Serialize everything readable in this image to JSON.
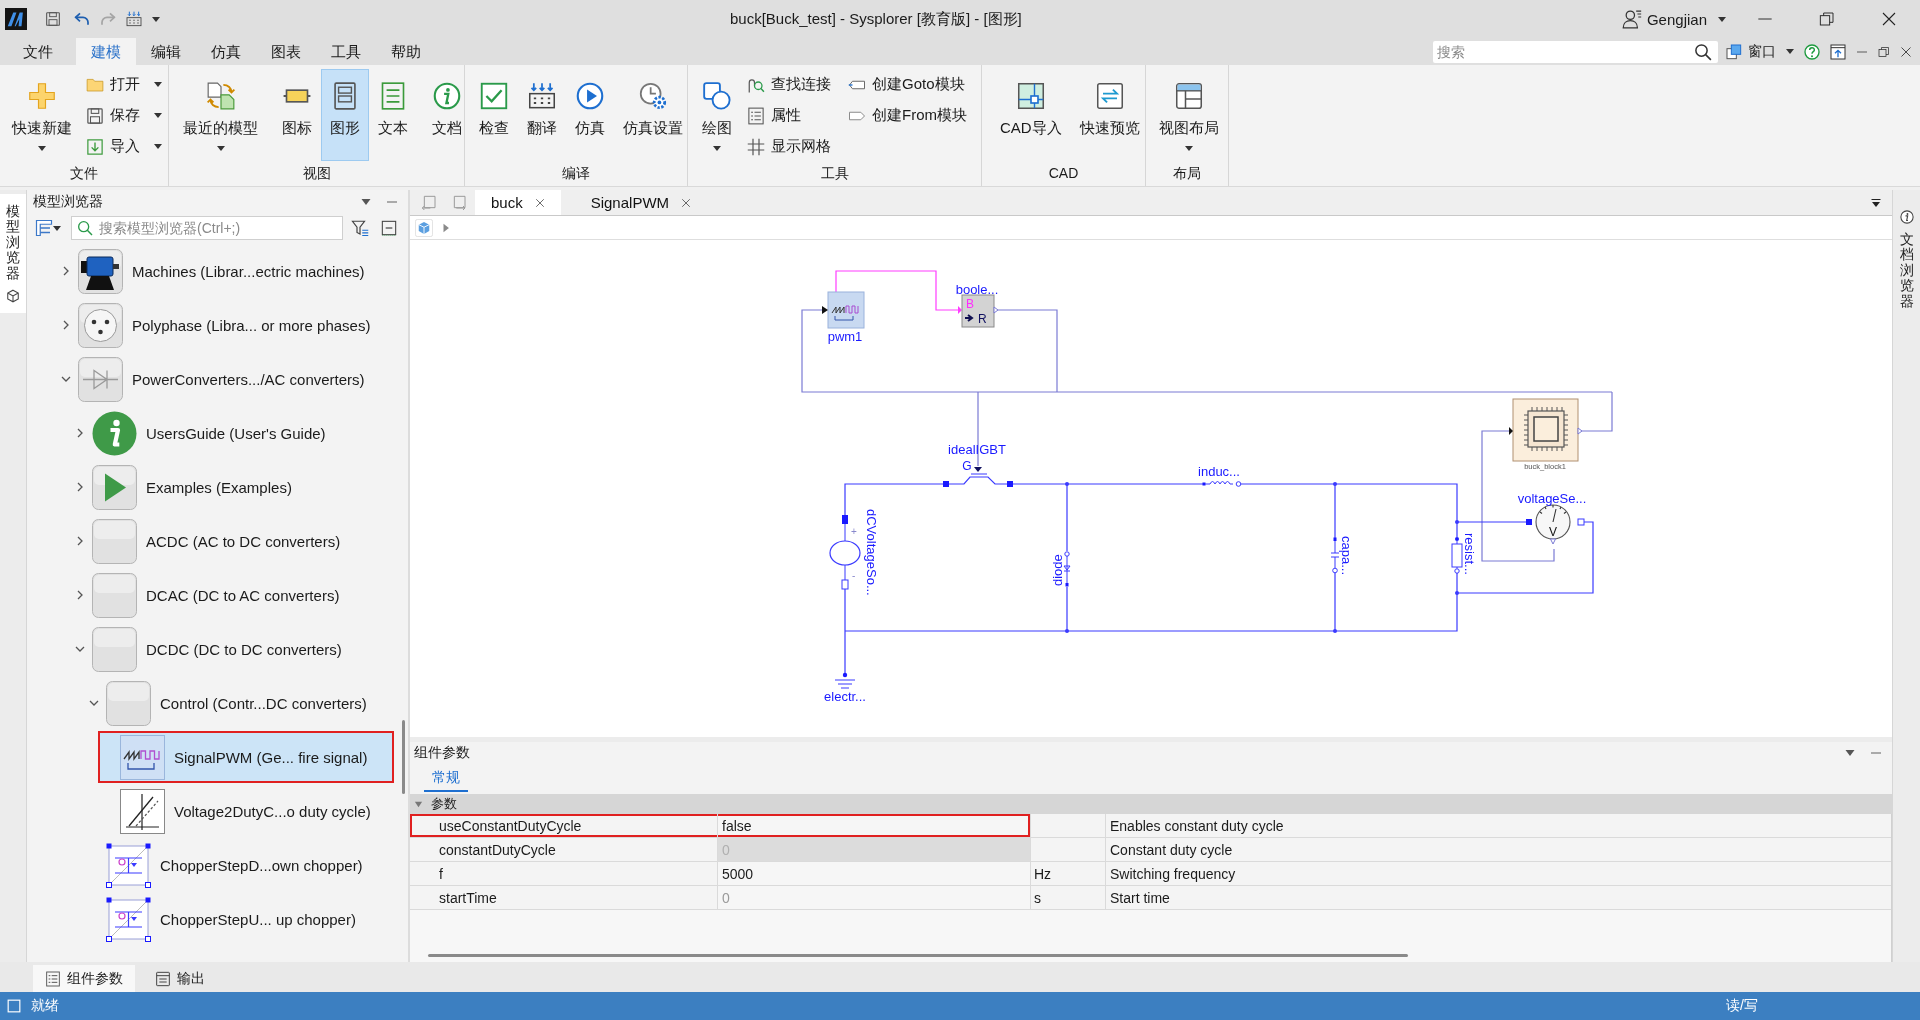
{
  "window": {
    "title": "buck[Buck_test] - Sysplorer [教育版] - [图形]",
    "user": "Gengjian"
  },
  "menu": [
    {
      "label": "文件",
      "selected": false
    },
    {
      "label": "建模",
      "selected": true
    },
    {
      "label": "编辑",
      "selected": false
    },
    {
      "label": "仿真",
      "selected": false
    },
    {
      "label": "图表",
      "selected": false
    },
    {
      "label": "工具",
      "selected": false
    },
    {
      "label": "帮助",
      "selected": false
    }
  ],
  "search": {
    "placeholder": "搜索"
  },
  "window_menu": {
    "label": "窗口"
  },
  "ribbon": {
    "groups": [
      {
        "label": "文件",
        "controls": [
          {
            "kind": "large",
            "label": "快速新建",
            "dropdown": true
          },
          {
            "kind": "stack",
            "items": [
              {
                "label": "打开",
                "dropdown": true
              },
              {
                "label": "保存",
                "dropdown": true
              },
              {
                "label": "导入",
                "dropdown": true
              }
            ]
          }
        ]
      },
      {
        "label": "视图",
        "controls": [
          {
            "kind": "large",
            "label": "最近的模型",
            "dropdown": true,
            "selected": false
          },
          {
            "kind": "separator"
          },
          {
            "kind": "large",
            "label": "图标",
            "selected": false
          },
          {
            "kind": "large",
            "label": "图形",
            "selected": true
          },
          {
            "kind": "large",
            "label": "文本",
            "selected": false
          },
          {
            "kind": "separator"
          },
          {
            "kind": "large",
            "label": "文档",
            "selected": false
          }
        ]
      },
      {
        "label": "编译",
        "controls": [
          {
            "kind": "large",
            "label": "检查"
          },
          {
            "kind": "large",
            "label": "翻译"
          },
          {
            "kind": "large",
            "label": "仿真"
          },
          {
            "kind": "large",
            "label": "仿真设置"
          }
        ]
      },
      {
        "label": "工具",
        "controls": [
          {
            "kind": "large",
            "label": "绘图",
            "dropdown": true
          },
          {
            "kind": "stack",
            "items": [
              {
                "label": "查找连接"
              },
              {
                "label": "属性"
              },
              {
                "label": "显示网格"
              }
            ]
          },
          {
            "kind": "stack",
            "items": [
              {
                "label": "创建Goto模块"
              },
              {
                "label": "创建From模块"
              }
            ]
          }
        ]
      },
      {
        "label": "CAD",
        "controls": [
          {
            "kind": "large",
            "label": "CAD导入"
          },
          {
            "kind": "large",
            "label": "快速预览"
          }
        ]
      },
      {
        "label": "布局",
        "controls": [
          {
            "kind": "large",
            "label": "视图布局",
            "dropdown": true
          }
        ]
      }
    ]
  },
  "side_tabs": {
    "left": {
      "label": "模型浏览器",
      "selected": true
    },
    "right": {
      "label": "文档浏览器",
      "selected": false
    }
  },
  "sidebar": {
    "title": "模型浏览器",
    "search": {
      "placeholder": "搜索模型浏览器(Ctrl+;)"
    },
    "tree": [
      {
        "label": "Machines (Librar...ectric machines)",
        "expanded": false,
        "selected": false,
        "highlighted": false
      },
      {
        "label": "Polyphase (Libra... or more phases)",
        "expanded": false,
        "selected": false,
        "highlighted": false
      },
      {
        "label": "PowerConverters.../AC converters)",
        "expanded": true,
        "selected": false,
        "highlighted": false,
        "children": [
          {
            "label": "UsersGuide (User's Guide)",
            "expanded": false,
            "selected": false,
            "highlighted": false
          },
          {
            "label": "Examples (Examples)",
            "expanded": false,
            "selected": false,
            "highlighted": false
          },
          {
            "label": "ACDC (AC to DC converters)",
            "expanded": false,
            "selected": false,
            "highlighted": false
          },
          {
            "label": "DCAC (DC to AC converters)",
            "expanded": false,
            "selected": false,
            "highlighted": false
          },
          {
            "label": "DCDC (DC to DC converters)",
            "expanded": true,
            "selected": false,
            "highlighted": false,
            "children": [
              {
                "label": "Control (Contr...DC converters)",
                "expanded": true,
                "selected": false,
                "highlighted": false,
                "children": [
                  {
                    "label": "SignalPWM (Ge... fire signal)",
                    "selected": true,
                    "highlighted": true
                  },
                  {
                    "label": "Voltage2DutyC...o duty cycle)",
                    "selected": false,
                    "highlighted": false
                  }
                ]
              },
              {
                "label": "ChopperStepD...own chopper)",
                "selected": false,
                "highlighted": false
              },
              {
                "label": "ChopperStepU... up chopper)",
                "selected": false,
                "highlighted": false
              }
            ]
          }
        ]
      }
    ]
  },
  "document_tabs": [
    {
      "label": "buck",
      "selected": true
    },
    {
      "label": "SignalPWM",
      "selected": false
    }
  ],
  "diagram": {
    "components": [
      {
        "label": "pwm1"
      },
      {
        "label": "boole...",
        "pins": [
          "B",
          "R"
        ]
      },
      {
        "label": "idealIGBT",
        "pins": [
          "G"
        ]
      },
      {
        "label": "dCVoltageSo...",
        "pins": [
          "+",
          "-"
        ]
      },
      {
        "label": "diode"
      },
      {
        "label": "induc..."
      },
      {
        "label": "capa..."
      },
      {
        "label": "resist..."
      },
      {
        "label": "voltageSe...",
        "pins": [
          "V"
        ]
      },
      {
        "label": "electr..."
      },
      {
        "label": "buck_block1"
      }
    ]
  },
  "parameters": {
    "title": "组件参数",
    "tabs": [
      {
        "label": "常规",
        "selected": true
      }
    ],
    "group": {
      "label": "参数",
      "expanded": true
    },
    "rows": [
      {
        "name": "useConstantDutyCycle",
        "value": "false",
        "description": "Enables constant duty cycle",
        "disabled": false,
        "highlighted": true
      },
      {
        "name": "constantDutyCycle",
        "placeholder": "0",
        "description": "Constant duty cycle",
        "disabled": true,
        "highlighted": false
      },
      {
        "name": "f",
        "value": "5000",
        "unit": "Hz",
        "description": "Switching frequency",
        "disabled": false,
        "highlighted": false
      },
      {
        "name": "startTime",
        "placeholder": "0",
        "unit": "s",
        "description": "Start time",
        "disabled": false,
        "highlighted": false
      }
    ]
  },
  "bottom_tabs": [
    {
      "label": "组件参数",
      "selected": true
    },
    {
      "label": "输出",
      "selected": false
    }
  ],
  "status_bar": {
    "message": "就绪",
    "mode": "读/写"
  }
}
